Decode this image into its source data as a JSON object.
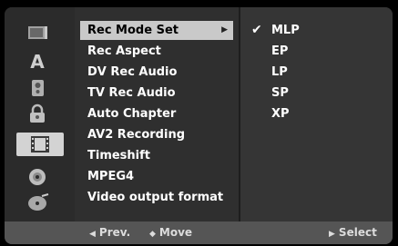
{
  "categories": [
    {
      "icon": "disc-icon"
    },
    {
      "icon": "language-icon",
      "glyph": "A"
    },
    {
      "icon": "audio-icon"
    },
    {
      "icon": "lock-icon"
    },
    {
      "icon": "recording-icon",
      "selected": true
    },
    {
      "icon": "dvd-disc-icon"
    },
    {
      "icon": "mp3-disc-icon"
    }
  ],
  "menu": {
    "items": [
      {
        "label": "Rec Mode Set",
        "selected": true
      },
      {
        "label": "Rec Aspect"
      },
      {
        "label": "DV Rec Audio"
      },
      {
        "label": "TV Rec Audio"
      },
      {
        "label": "Auto Chapter"
      },
      {
        "label": "AV2 Recording"
      },
      {
        "label": "Timeshift"
      },
      {
        "label": "MPEG4"
      },
      {
        "label": "Video output format"
      }
    ],
    "submenu_arrow": "▶"
  },
  "options": {
    "check_glyph": "✔",
    "items": [
      {
        "label": "MLP",
        "checked": true
      },
      {
        "label": "EP"
      },
      {
        "label": "LP"
      },
      {
        "label": "SP"
      },
      {
        "label": "XP"
      }
    ]
  },
  "footer": {
    "prev_glyph": "◀",
    "prev_label": "Prev.",
    "move_glyph": "◆",
    "move_label": "Move",
    "select_glyph": "▶",
    "select_label": "Select"
  },
  "colors": {
    "background": "#000000",
    "panel": "#2d2d2d",
    "highlight": "#c9c9c9",
    "bottom_bar": "#555555",
    "text": "#ffffff"
  }
}
